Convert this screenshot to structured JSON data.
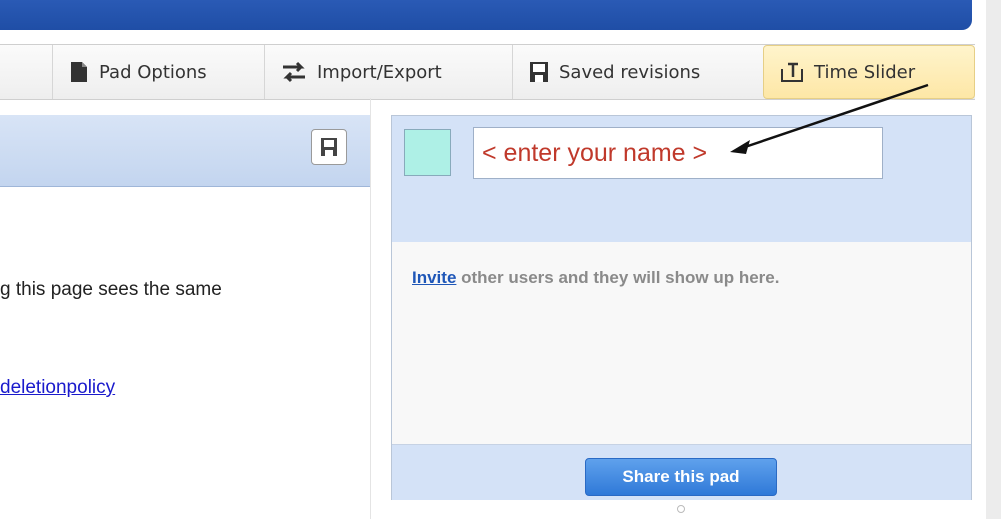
{
  "toolbar": {
    "pad_options": "Pad Options",
    "import_export": "Import/Export",
    "saved_revisions": "Saved revisions",
    "time_slider": "Time Slider"
  },
  "editor": {
    "line1": "g this page sees the same",
    "line2": "deletionpolicy"
  },
  "users": {
    "name_placeholder": "< enter your name >",
    "swatch_color": "#aef0e6",
    "invite_link": "Invite",
    "invite_text": " other users and they will show up here.",
    "share_button": "Share this pad"
  },
  "colors": {
    "header_blue": "#2a5ab5",
    "highlight_yellow": "#fde7a6",
    "name_text": "#c0392b",
    "share_blue": "#2f79d8"
  }
}
